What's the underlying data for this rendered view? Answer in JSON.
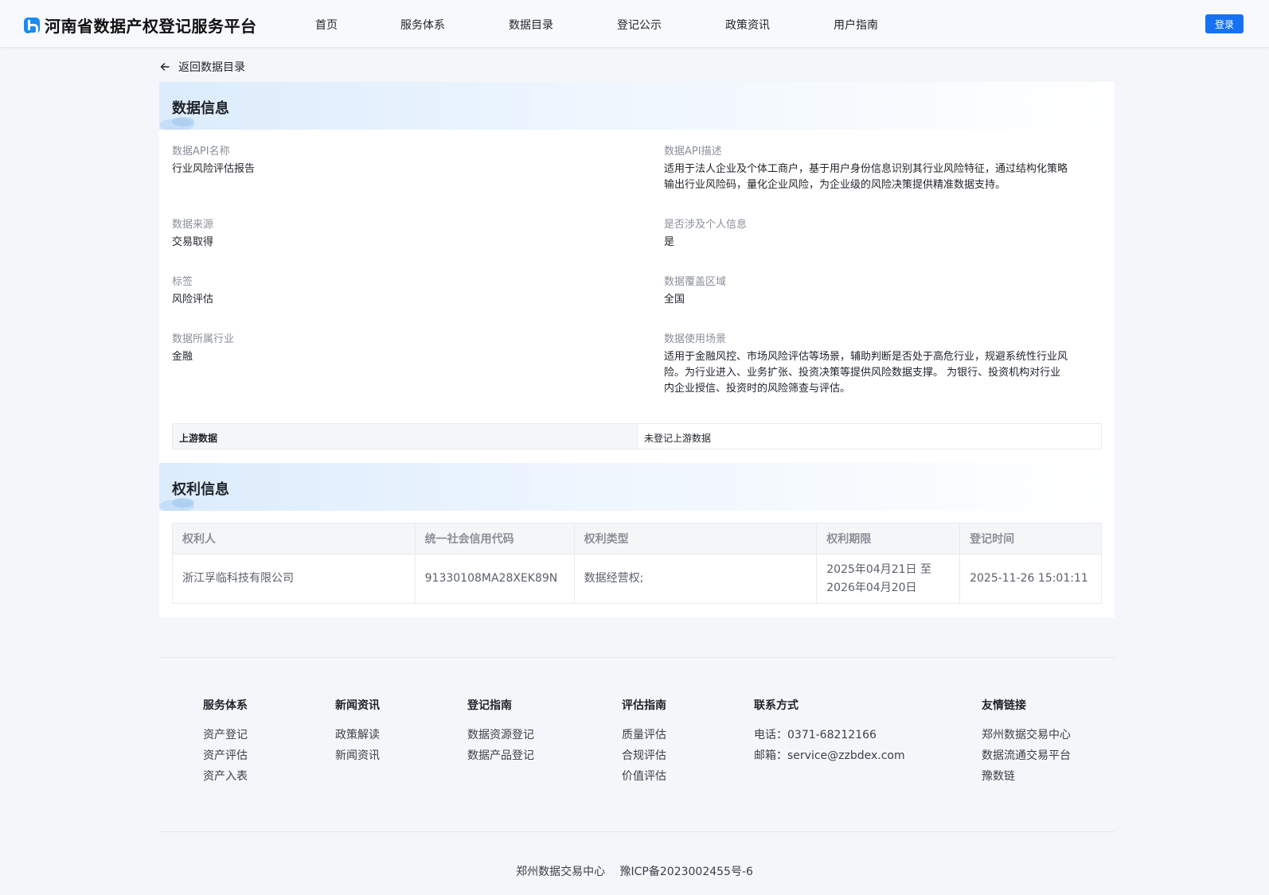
{
  "header": {
    "site_title": "河南省数据产权登记服务平台",
    "nav": [
      "首页",
      "服务体系",
      "数据目录",
      "登记公示",
      "政策资讯",
      "用户指南"
    ],
    "login_label": "登录"
  },
  "back_link": "返回数据目录",
  "data_info": {
    "title": "数据信息",
    "fields": {
      "api_name": {
        "label": "数据API名称",
        "value": "行业风险评估报告"
      },
      "api_desc": {
        "label": "数据API描述",
        "value_lines": [
          "适用于法人企业及个体工商户，基于用户身份信息识别其行业风险特征，通过结构化策略",
          "输出行业风险码，量化企业风险，为企业级的风险决策提供精准数据支持。"
        ]
      },
      "source": {
        "label": "数据来源",
        "value": "交易取得"
      },
      "personal_info": {
        "label": "是否涉及个人信息",
        "value": "是"
      },
      "tag": {
        "label": "标签",
        "value": "风险评估"
      },
      "coverage": {
        "label": "数据覆盖区域",
        "value": "全国"
      },
      "industry": {
        "label": "数据所属行业",
        "value": "金融"
      },
      "scenario": {
        "label": "数据使用场景",
        "value_lines": [
          "适用于金融风控、市场风险评估等场景，辅助判断是否处于高危行业，规避系统性行业风",
          "险。为行业进入、业务扩张、投资决策等提供风险数据支撑。 为银行、投资机构对行业",
          "内企业授信、投资时的风险筛查与评估。"
        ]
      }
    },
    "upstream": {
      "label": "上游数据",
      "value": "未登记上游数据"
    }
  },
  "rights_info": {
    "title": "权利信息",
    "columns": [
      "权利人",
      "统一社会信用代码",
      "权利类型",
      "权利期限",
      "登记时间"
    ],
    "rows": [
      {
        "holder": "浙江孚临科技有限公司",
        "credit_code": "91330108MA28XEK89N",
        "type": "数据经营权;",
        "term_line1": "2025年04月21日 至",
        "term_line2": "2026年04月20日",
        "registered_at": "2025-11-26 15:01:11"
      }
    ]
  },
  "footer": {
    "columns": [
      {
        "title": "服务体系",
        "items": [
          "资产登记",
          "资产评估",
          "资产入表"
        ]
      },
      {
        "title": "新闻资讯",
        "items": [
          "政策解读",
          "新闻资讯"
        ]
      },
      {
        "title": "登记指南",
        "items": [
          "数据资源登记",
          "数据产品登记"
        ]
      },
      {
        "title": "评估指南",
        "items": [
          "质量评估",
          "合规评估",
          "价值评估"
        ]
      },
      {
        "title": "联系方式",
        "items": [
          "电话：0371-68212166",
          "邮箱：service@zzbdex.com"
        ]
      },
      {
        "title": "友情链接",
        "items": [
          "郑州数据交易中心",
          "数据流通交易平台",
          "豫数链"
        ]
      }
    ],
    "org": "郑州数据交易中心",
    "icp": "豫ICP备2023002455号-6"
  },
  "colors": {
    "accent": "#1672f3",
    "page_bg": "#f4f6fa"
  }
}
